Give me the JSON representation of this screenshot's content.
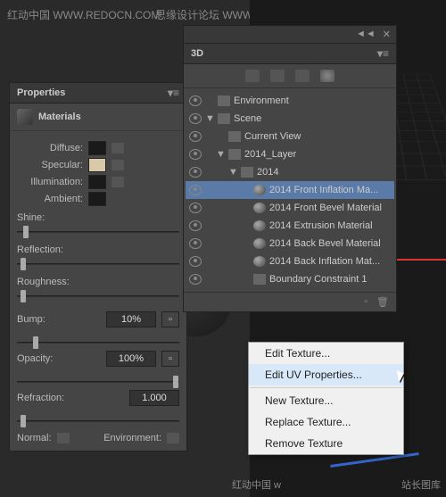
{
  "watermarks": {
    "tl": "红动中国 WWW.REDOCN.COM",
    "tr": "思缘设计论坛 WWW.MISSYUAN.COM",
    "br": "站长图库",
    "br2": "红动中国 w"
  },
  "props": {
    "title": "Properties",
    "section": "Materials",
    "labels": {
      "diffuse": "Diffuse:",
      "specular": "Specular:",
      "illumination": "Illumination:",
      "ambient": "Ambient:",
      "shine": "Shine:",
      "reflection": "Reflection:",
      "roughness": "Roughness:",
      "bump": "Bump:",
      "opacity": "Opacity:",
      "refraction": "Refraction:",
      "normal": "Normal:",
      "environment": "Environment:"
    },
    "values": {
      "bump": "10%",
      "opacity": "100%",
      "refraction": "1.000"
    },
    "swatches": {
      "diffuse": "#1a1a1a",
      "specular": "#d8c9a8",
      "illumination": "#1a1a1a",
      "ambient": "#1a1a1a"
    },
    "thumbs": {
      "shine": 4,
      "reflection": 2,
      "roughness": 2
    }
  },
  "panel3d": {
    "title": "3D",
    "tree": [
      {
        "label": "Environment",
        "eye": true,
        "twist": "",
        "icon": "env",
        "indent": 0
      },
      {
        "label": "Scene",
        "eye": true,
        "twist": "▼",
        "icon": "scene",
        "indent": 0
      },
      {
        "label": "Current View",
        "eye": true,
        "twist": "",
        "icon": "cam",
        "indent": 1
      },
      {
        "label": "2014_Layer",
        "eye": true,
        "twist": "▼",
        "icon": "fold",
        "indent": 1
      },
      {
        "label": "2014",
        "eye": true,
        "twist": "▼",
        "icon": "t",
        "indent": 2
      },
      {
        "label": "2014 Front Inflation Ma...",
        "eye": true,
        "twist": "",
        "icon": "sph",
        "indent": 3,
        "sel": true
      },
      {
        "label": "2014 Front Bevel Material",
        "eye": true,
        "twist": "",
        "icon": "sph",
        "indent": 3
      },
      {
        "label": "2014 Extrusion Material",
        "eye": true,
        "twist": "",
        "icon": "sph",
        "indent": 3
      },
      {
        "label": "2014 Back Bevel Material",
        "eye": true,
        "twist": "",
        "icon": "sph",
        "indent": 3
      },
      {
        "label": "2014 Back Inflation Mat...",
        "eye": true,
        "twist": "",
        "icon": "sph",
        "indent": 3
      },
      {
        "label": "Boundary Constraint 1",
        "eye": true,
        "twist": "",
        "icon": "con",
        "indent": 3
      }
    ]
  },
  "ctx": {
    "items": [
      "Edit Texture...",
      "Edit UV Properties...",
      "New Texture...",
      "Replace Texture...",
      "Remove Texture"
    ],
    "hov": 1,
    "sep_after": [
      1
    ]
  }
}
